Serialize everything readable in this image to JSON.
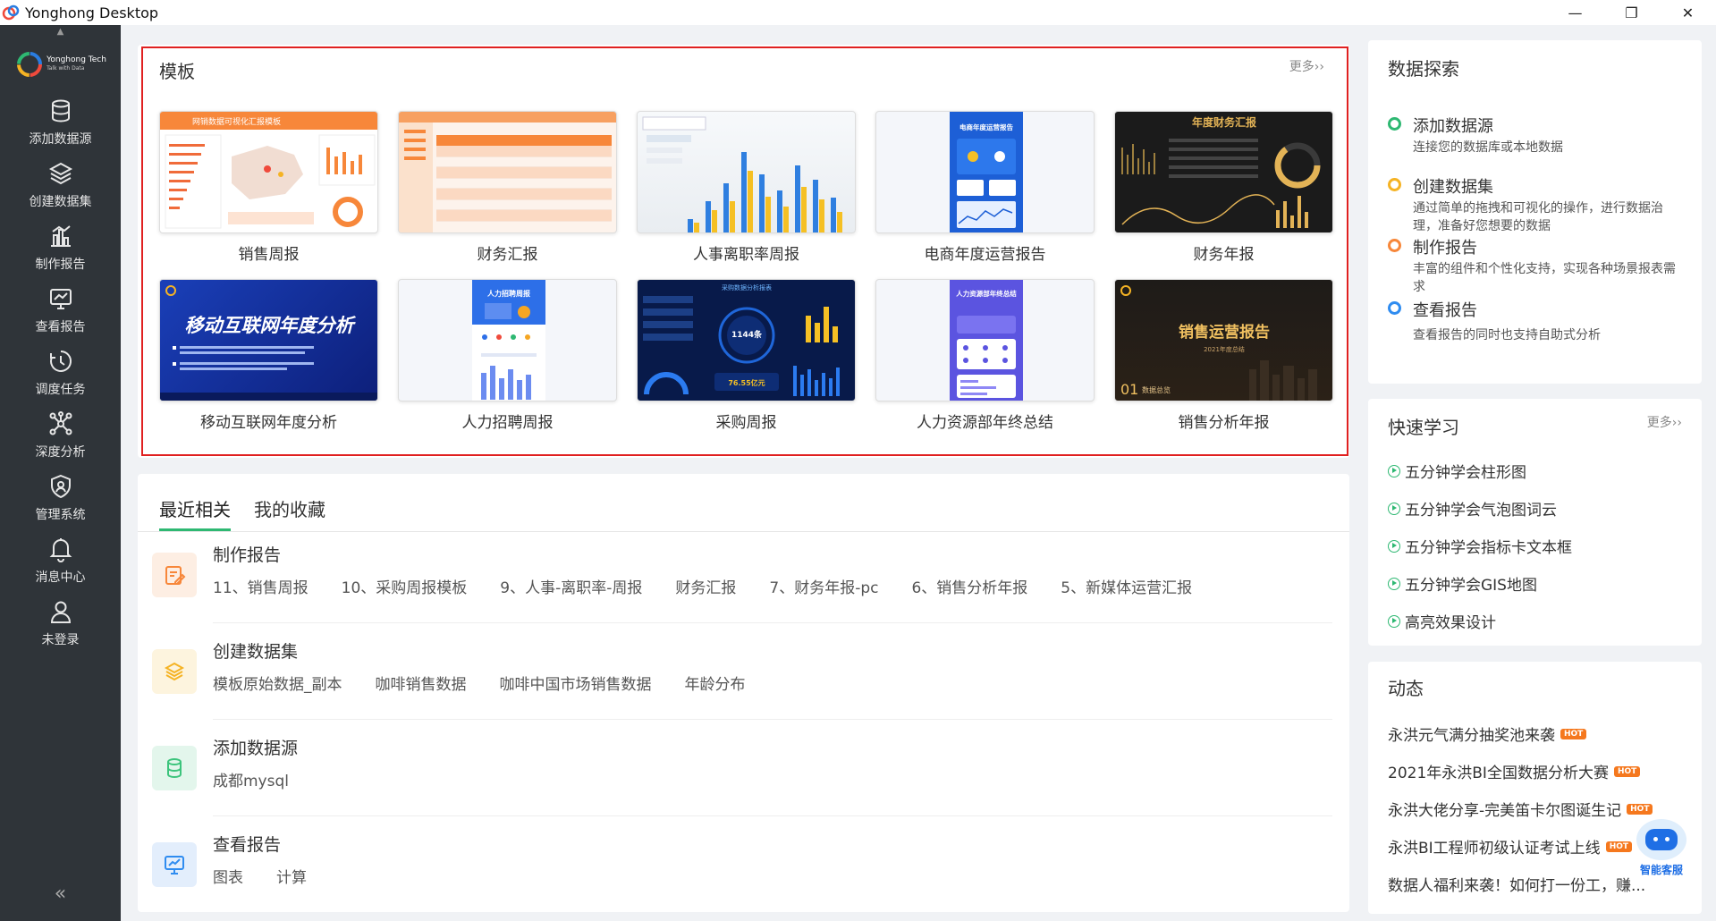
{
  "window": {
    "title": "Yonghong Desktop",
    "minimize": "—",
    "maximize": "❐",
    "close": "✕"
  },
  "brand": {
    "name": "Yonghong Tech",
    "tagline": "Talk with Data"
  },
  "sidebar": {
    "items": [
      {
        "label": "添加数据源",
        "icon": "database-icon"
      },
      {
        "label": "创建数据集",
        "icon": "layers-icon"
      },
      {
        "label": "制作报告",
        "icon": "bar-chart-icon"
      },
      {
        "label": "查看报告",
        "icon": "monitor-chart-icon"
      },
      {
        "label": "调度任务",
        "icon": "clock-icon"
      },
      {
        "label": "深度分析",
        "icon": "network-icon"
      },
      {
        "label": "管理系统",
        "icon": "shield-icon"
      },
      {
        "label": "消息中心",
        "icon": "bell-icon"
      },
      {
        "label": "未登录",
        "icon": "user-icon"
      }
    ],
    "collapse": "«"
  },
  "templates": {
    "title": "模板",
    "more": "更多››",
    "items": [
      {
        "label": "销售周报",
        "theme": "light-orange"
      },
      {
        "label": "财务汇报",
        "theme": "light-orange-table"
      },
      {
        "label": "人事离职率周报",
        "theme": "light-blue-bars"
      },
      {
        "label": "电商年度运营报告",
        "theme": "blue-mobile"
      },
      {
        "label": "财务年报",
        "theme": "dark-gold"
      },
      {
        "label": "移动互联网年度分析",
        "theme": "blue-cover"
      },
      {
        "label": "人力招聘周报",
        "theme": "blue-mobile-hr"
      },
      {
        "label": "采购周报",
        "theme": "dark-blue-dashboard"
      },
      {
        "label": "人力资源部年终总结",
        "theme": "purple-mobile"
      },
      {
        "label": "销售分析年报",
        "theme": "dark-gold-cover"
      }
    ],
    "thumb_text": {
      "t1": "网销数据可视化汇报模板",
      "t4": "电商年度运营报告",
      "t5": "年度财务汇报",
      "t6": "移动互联网年度分析",
      "t7": "人力招聘周报",
      "t8": "采购数据分析报表",
      "t8_value": "1144条",
      "t8_value2": "76.55亿元",
      "t9": "人力资源部年终总结",
      "t10": "销售运营报告",
      "t10_sub": "2021年度总结",
      "t10_index": "01",
      "t10_index_label": "数据总览"
    }
  },
  "recent": {
    "tabs": [
      "最近相关",
      "我的收藏"
    ],
    "sections": [
      {
        "title": "制作报告",
        "icon": "report-edit-icon",
        "color": "#f7873a",
        "bg": "#fdeee3",
        "links": [
          "11、销售周报",
          "10、采购周报模板",
          "9、人事-离职率-周报",
          "财务汇报",
          "7、财务年报-pc",
          "6、销售分析年报",
          "5、新媒体运营汇报"
        ]
      },
      {
        "title": "创建数据集",
        "icon": "layers-icon",
        "color": "#f5b324",
        "bg": "#fdf4de",
        "links": [
          "模板原始数据_副本",
          "咖啡销售数据",
          "咖啡中国市场销售数据",
          "年龄分布"
        ]
      },
      {
        "title": "添加数据源",
        "icon": "database-icon",
        "color": "#3cc47c",
        "bg": "#e3f6ec",
        "links": [
          "成都mysql"
        ]
      },
      {
        "title": "查看报告",
        "icon": "monitor-chart-icon",
        "color": "#2f8cf0",
        "bg": "#e3eefc",
        "links": [
          "图表",
          "计算"
        ]
      }
    ]
  },
  "explore": {
    "title": "数据探索",
    "steps": [
      {
        "title": "添加数据源",
        "desc": "连接您的数据库或本地数据",
        "color": "#2eb872"
      },
      {
        "title": "创建数据集",
        "desc": "通过简单的拖拽和可视化的操作，进行数据治理，准备好您想要的数据",
        "color": "#f5b324"
      },
      {
        "title": "制作报告",
        "desc": "丰富的组件和个性化支持，实现各种场景报表需求",
        "color": "#f7873a"
      },
      {
        "title": "查看报告",
        "desc": "查看报告的同时也支持自助式分析",
        "color": "#2f8cf0"
      }
    ]
  },
  "learn": {
    "title": "快速学习",
    "more": "更多››",
    "items": [
      "五分钟学会柱形图",
      "五分钟学会气泡图词云",
      "五分钟学会指标卡文本框",
      "五分钟学会GIS地图",
      "高亮效果设计"
    ]
  },
  "news": {
    "title": "动态",
    "hot": "HOT",
    "items": [
      "永洪元气满分抽奖池来袭",
      "2021年永洪BI全国数据分析大赛",
      "永洪大佬分享-完美笛卡尔图诞生记",
      "永洪BI工程师初级认证考试上线",
      "数据人福利来袭！如何打一份工，赚..."
    ]
  },
  "assistant": {
    "label": "智能客服"
  }
}
